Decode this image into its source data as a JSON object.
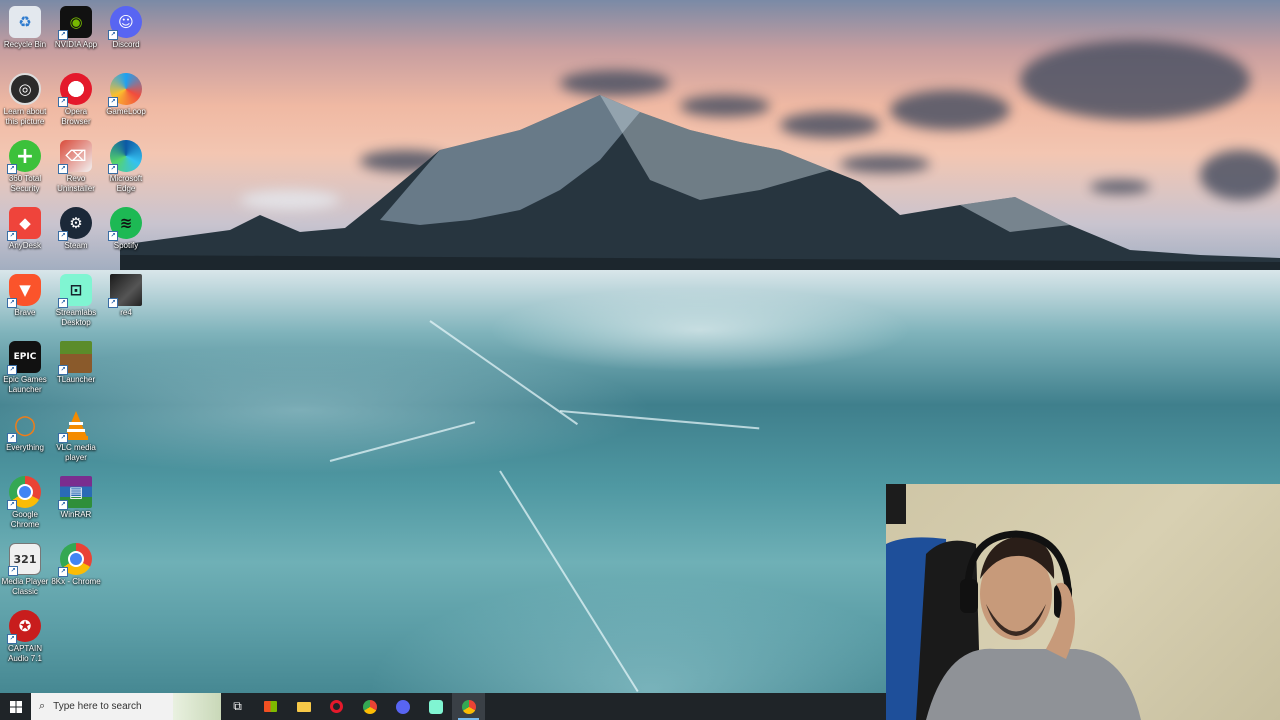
{
  "desktop": {
    "icons": [
      {
        "label": "Recycle Bin",
        "icon": "recycle-bin-icon",
        "color": "#dfe6ee"
      },
      {
        "label": "NVIDIA App",
        "icon": "nvidia-icon",
        "color": "#76b900"
      },
      {
        "label": "Discord",
        "icon": "discord-icon",
        "color": "#5865f2"
      },
      {
        "label": "Learn about this picture",
        "icon": "camera-info-icon",
        "color": "#2b2b2b"
      },
      {
        "label": "Opera Browser",
        "icon": "opera-icon",
        "color": "#e4192b"
      },
      {
        "label": "GameLoop",
        "icon": "gameloop-icon",
        "color": "#1da1f2"
      },
      {
        "label": "360 Total Security",
        "icon": "360-security-icon",
        "color": "#3cc13b"
      },
      {
        "label": "Revo Uninstaller",
        "icon": "revo-uninstaller-icon",
        "color": "#c63b3b"
      },
      {
        "label": "Microsoft Edge",
        "icon": "edge-icon",
        "color": "#1a9fd9"
      },
      {
        "label": "AnyDesk",
        "icon": "anydesk-icon",
        "color": "#ef443b"
      },
      {
        "label": "Steam",
        "icon": "steam-icon",
        "color": "#1b2838"
      },
      {
        "label": "Spotify",
        "icon": "spotify-icon",
        "color": "#1db954"
      },
      {
        "label": "Brave",
        "icon": "brave-icon",
        "color": "#fb542b"
      },
      {
        "label": "Streamlabs Desktop",
        "icon": "streamlabs-icon",
        "color": "#80f5d2"
      },
      {
        "label": "re4",
        "icon": "re4-game-icon",
        "color": "#2a2a2a"
      },
      {
        "label": "Epic Games Launcher",
        "icon": "epic-games-icon",
        "color": "#111111"
      },
      {
        "label": "TLauncher",
        "icon": "tlauncher-icon",
        "color": "#5b8c2a"
      },
      {
        "label": "Everything",
        "icon": "everything-search-icon",
        "color": "#f07d18"
      },
      {
        "label": "VLC media player",
        "icon": "vlc-icon",
        "color": "#f48b00"
      },
      {
        "label": "Google Chrome",
        "icon": "chrome-icon",
        "color": "#4285f4"
      },
      {
        "label": "WinRAR",
        "icon": "winrar-icon",
        "color": "#7a2d8f"
      },
      {
        "label": "Media Player Classic",
        "icon": "media-player-classic-icon",
        "color": "#3c3c3c"
      },
      {
        "label": "8Kx - Chrome",
        "icon": "chrome-app-icon",
        "color": "#4285f4"
      },
      {
        "label": "CAPTAIN Audio 7.1",
        "icon": "captain-audio-icon",
        "color": "#c81d1d"
      }
    ]
  },
  "taskbar": {
    "search_placeholder": "Type here to search",
    "buttons": [
      {
        "name": "task-view",
        "icon": "task-view-icon"
      },
      {
        "name": "microsoft-store",
        "icon": "store-icon"
      },
      {
        "name": "file-explorer",
        "icon": "folder-icon"
      },
      {
        "name": "opera",
        "icon": "opera-icon"
      },
      {
        "name": "chrome",
        "icon": "chrome-icon"
      },
      {
        "name": "discord",
        "icon": "discord-icon"
      },
      {
        "name": "streamlabs",
        "icon": "streamlabs-icon"
      },
      {
        "name": "chrome-active",
        "icon": "chrome-icon"
      }
    ]
  },
  "colors": {
    "taskbar_bg": "#1f2428",
    "search_bg": "#f2f2f2",
    "active_indicator": "#76b9ed"
  }
}
